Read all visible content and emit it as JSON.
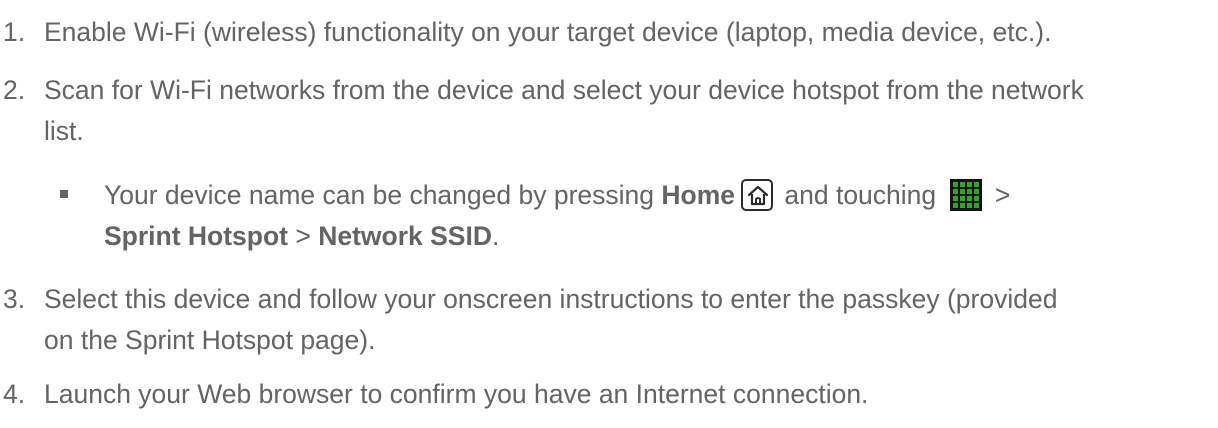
{
  "steps": [
    {
      "number": "1.",
      "text": "Enable Wi-Fi (wireless) functionality on your target device (laptop, media device, etc.)."
    },
    {
      "number": "2.",
      "text_line1": "Scan for Wi-Fi networks from the device and select your device hotspot from the network",
      "text_line2": "list.",
      "note": {
        "pre_home": "Your device name can be changed by pressing ",
        "home_label": "Home",
        "mid": " and touching ",
        "after_apps": " >",
        "sprint_hotspot": "Sprint Hotspot",
        "separator": " > ",
        "network_ssid": "Network SSID",
        "end": "."
      }
    },
    {
      "number": "3.",
      "text_line1": "Select this device and follow your onscreen instructions to enter the passkey (provided",
      "text_line2": "on the Sprint Hotspot page)."
    },
    {
      "number": "4.",
      "text": "Launch your Web browser to confirm you have an Internet connection."
    }
  ],
  "icons": {
    "home": "home-icon",
    "apps": "apps-grid-icon"
  },
  "colors": {
    "text": "#646464",
    "icon_dark": "#141414"
  }
}
